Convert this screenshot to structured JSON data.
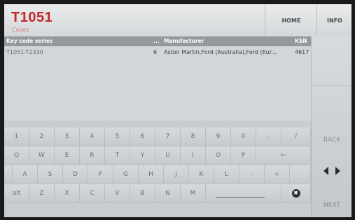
{
  "header": {
    "title": "T1051",
    "subtitle": "Codes",
    "home_label": "HOME",
    "info_label": "INFO"
  },
  "table": {
    "columns": [
      "Key code series",
      "...",
      "Manufacturer",
      "KSN"
    ],
    "rows": [
      {
        "series": "T1051-T2330",
        "count": "6",
        "manufacturer": "Aston Martin,Ford (Australia),Ford (Eur...",
        "ksn": "4617"
      }
    ]
  },
  "keyboard": {
    "row1": [
      "1",
      "2",
      "3",
      "4",
      "5",
      "6",
      "7",
      "8",
      "9",
      "0",
      ".",
      "/"
    ],
    "row2": [
      "Q",
      "W",
      "E",
      "R",
      "T",
      "Y",
      "U",
      "I",
      "O",
      "P",
      "←"
    ],
    "row3": [
      "A",
      "S",
      "D",
      "F",
      "G",
      "H",
      "J",
      "K",
      "L",
      "-",
      "+"
    ],
    "row4": [
      "alt",
      "Z",
      "X",
      "C",
      "V",
      "B",
      "N",
      "M"
    ],
    "clear_glyph": "✖"
  },
  "side": {
    "back_label": "BACK",
    "next_label": "NEXT"
  }
}
